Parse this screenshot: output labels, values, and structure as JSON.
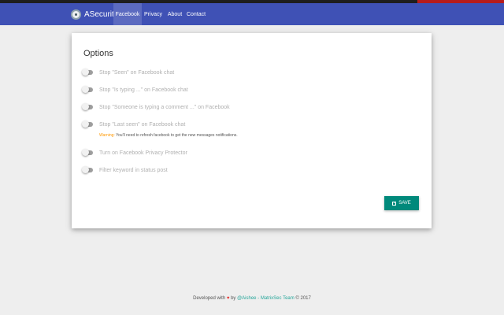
{
  "navbar": {
    "brand": "ASecurity",
    "links": [
      {
        "label": "Facebook",
        "active": true
      },
      {
        "label": "Privacy",
        "active": false
      },
      {
        "label": "About",
        "active": false
      },
      {
        "label": "Contact",
        "active": false
      }
    ]
  },
  "options": {
    "title": "Options",
    "items": [
      {
        "label": "Stop \"Seen\" on Facebook chat",
        "enabled": false
      },
      {
        "label": "Stop \"Is typing ...\" on Facebook chat",
        "enabled": false
      },
      {
        "label": "Stop \"Someone is typing a comment ...\" on Facebook",
        "enabled": false
      },
      {
        "label": "Stop \"Last seen\" on Facebook chat",
        "enabled": false
      },
      {
        "label": "Turn on Facebook Privacy Protector",
        "enabled": false
      },
      {
        "label": "Filter keyword in status post",
        "enabled": false
      }
    ],
    "warning_prefix": "Warning:",
    "warning_text": "You'll need to refresh facebook to get the new messages notifications.",
    "save_label": "SAVE"
  },
  "footer": {
    "prefix": "Developed with",
    "heart": "♥",
    "by": "by",
    "author": "@Aishee - MatrixSec Team",
    "suffix": "© 2017"
  },
  "colors": {
    "navbar": "#3f51b5",
    "navbar_active": "#5c6bc0",
    "save_button": "#00897b",
    "warning": "#ff9800"
  }
}
